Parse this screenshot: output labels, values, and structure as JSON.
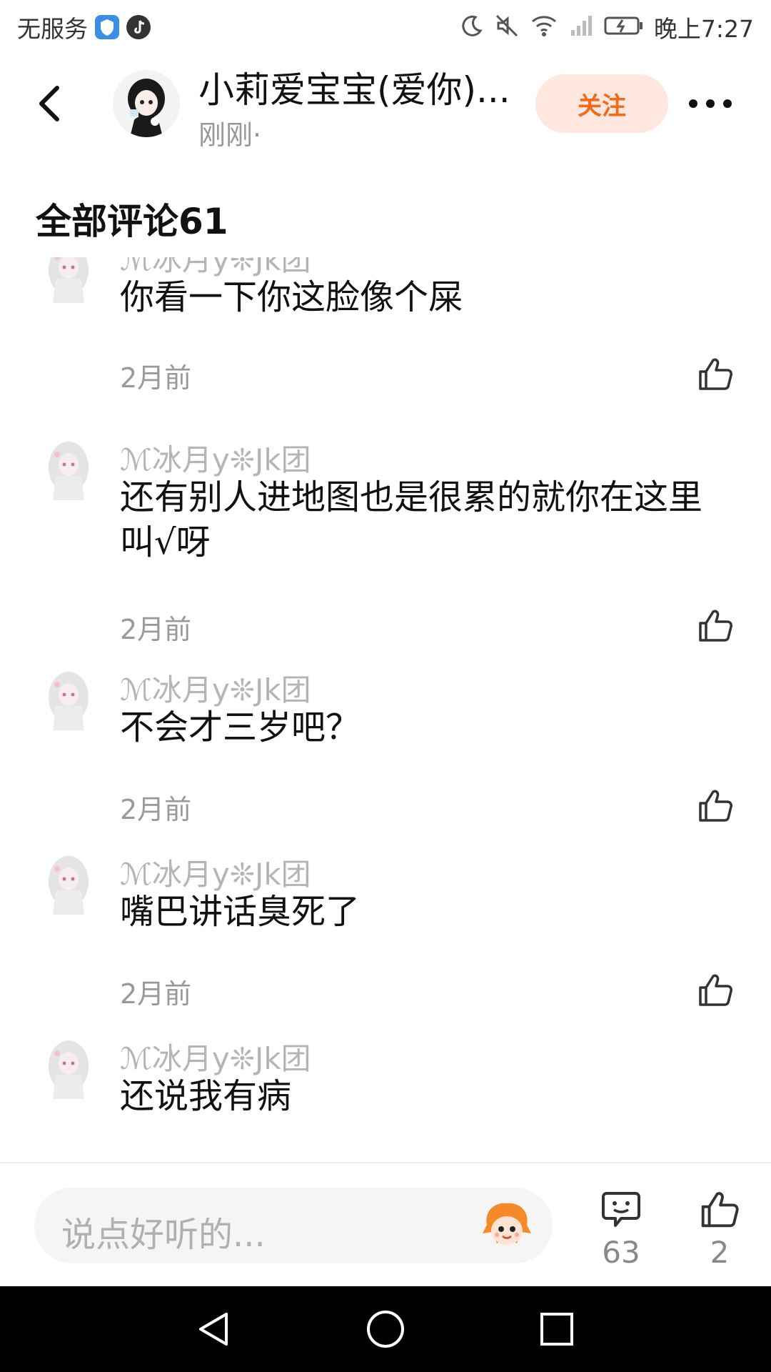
{
  "status_bar": {
    "carrier": "无服务",
    "time": "晚上7:27"
  },
  "header": {
    "title": "小莉爱宝宝(爱你)...",
    "subtitle": "刚刚·",
    "follow_label": "关注"
  },
  "section": {
    "title": "全部评论61"
  },
  "comments": [
    {
      "user": "ℳ冰月y❊Jk团",
      "text": "你看一下你这脸像个屎",
      "time": "2月前"
    },
    {
      "user": "ℳ冰月y❊Jk团",
      "text": "还有别人进地图也是很累的就你在这里叫√呀",
      "time": "2月前"
    },
    {
      "user": "ℳ冰月y❊Jk团",
      "text": "不会才三岁吧？",
      "time": "2月前"
    },
    {
      "user": "ℳ冰月y❊Jk团",
      "text": "嘴巴讲话臭死了",
      "time": "2月前"
    },
    {
      "user": "ℳ冰月y❊Jk团",
      "text": "还说我有病",
      "time": ""
    }
  ],
  "bottom_bar": {
    "input_placeholder": "说点好听的...",
    "comment_count": "63",
    "like_count": "2"
  },
  "colors": {
    "accent": "#f26a1b",
    "follow_bg": "#fde7de",
    "muted_text": "#999999"
  },
  "icons": [
    "back-arrow-icon",
    "more-dots-icon",
    "thumbs-up-icon",
    "comment-bubble-icon",
    "emoji-mascot-icon",
    "nav-back-icon",
    "nav-home-icon",
    "nav-recents-icon"
  ]
}
